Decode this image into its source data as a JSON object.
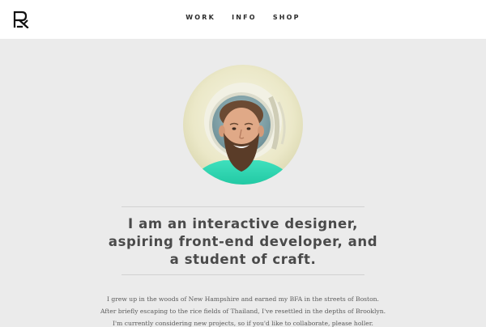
{
  "header": {
    "logo_alt": "R logo",
    "nav": [
      {
        "label": "WORK"
      },
      {
        "label": "INFO"
      },
      {
        "label": "SHOP"
      }
    ]
  },
  "profile": {
    "photo_alt": "Portrait of a bearded designer wearing a space helmet"
  },
  "headline": {
    "lines": [
      "I am an interactive designer,",
      "aspiring front-end developer, and",
      "a student of craft."
    ]
  },
  "bio": {
    "lines": [
      "I grew up in the woods of New Hampshire and earned my BFA in the streets of Boston.",
      "After briefly escaping to the rice fields of Thailand, I've resettled in the depths of Brooklyn.",
      "I'm currently considering new projects, so if you'd like to collaborate, please holler."
    ]
  },
  "colors": {
    "background": "#ebebeb",
    "header_bg": "#ffffff",
    "shirt_teal": "#2bd6b0",
    "text_dark": "#2b2b2b"
  }
}
